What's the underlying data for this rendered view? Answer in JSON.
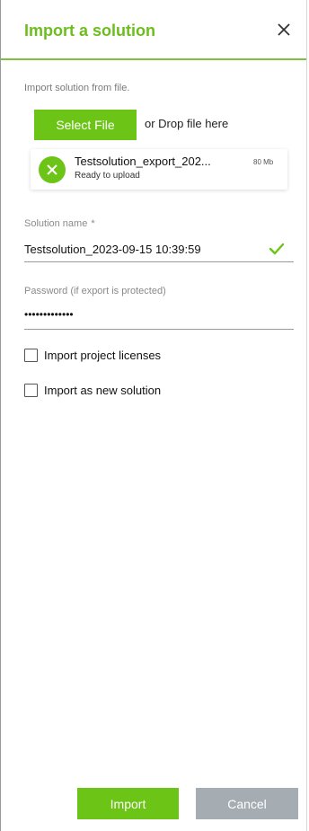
{
  "header": {
    "title": "Import a solution",
    "close_icon": "close-icon"
  },
  "upload": {
    "hint": "Import solution from file.",
    "select_button_label": "Select File",
    "drop_text": "or Drop file here",
    "file": {
      "name": "Testsolution_export_202...",
      "size": "80 Mb",
      "status": "Ready to upload",
      "status_icon": "remove-file-icon"
    }
  },
  "form": {
    "solution_name": {
      "label": "Solution name",
      "required_marker": "*",
      "value": "Testsolution_2023-09-15 10:39:59",
      "valid_icon": "checkmark-icon"
    },
    "password": {
      "label": "Password (if export is protected)",
      "value": "•••••••••••••"
    },
    "options": [
      {
        "label": "Import project licenses",
        "checked": false
      },
      {
        "label": "Import as new solution",
        "checked": false
      }
    ]
  },
  "footer": {
    "import_label": "Import",
    "cancel_label": "Cancel"
  },
  "colors": {
    "accent": "#6cc417",
    "title": "#6cbd1e",
    "cancel": "#a6adb2"
  }
}
